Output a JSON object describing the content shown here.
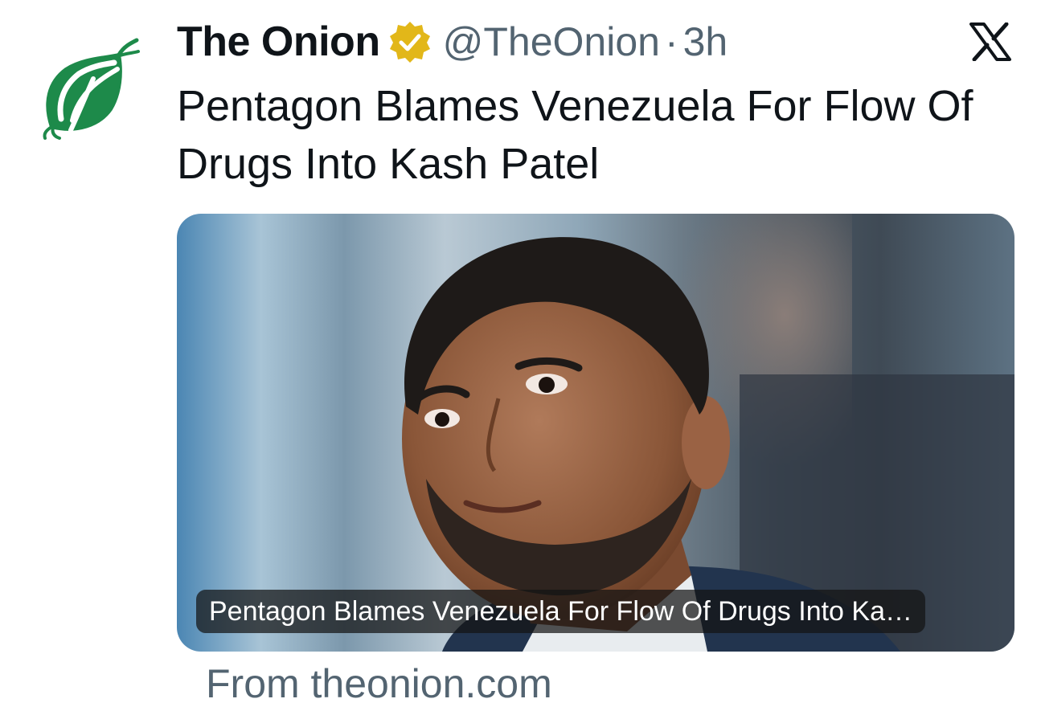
{
  "tweet": {
    "display_name": "The Onion",
    "handle": "@TheOnion",
    "separator": "·",
    "time": "3h",
    "text": "Pentagon Blames Venezuela For Flow Of Drugs Into Kash Patel",
    "avatar_icon": "onion-logo-icon",
    "verified_icon": "gold-verified-badge-icon",
    "platform_icon": "x-logo-icon"
  },
  "card": {
    "caption": "Pentagon Blames Venezuela For Flow Of Drugs Into Ka…",
    "image": "news-photo-man-portrait",
    "source": "From theonion.com"
  },
  "colors": {
    "text_primary": "#0f1419",
    "text_secondary": "#536471",
    "onion_green": "#1d8a4a",
    "verified_gold": "#e2b719"
  }
}
